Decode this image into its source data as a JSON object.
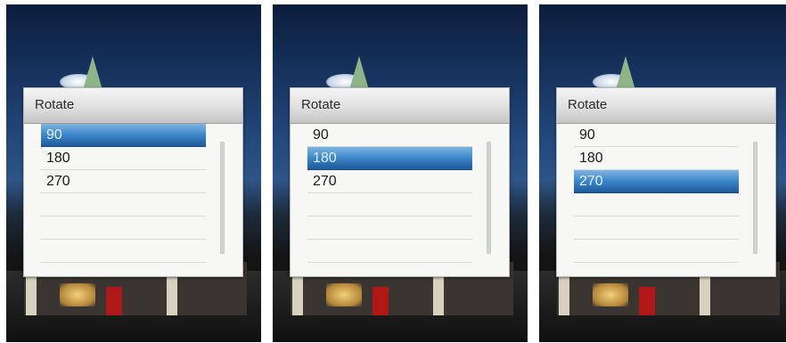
{
  "screens": [
    {
      "title": "Rotate",
      "options": [
        "90",
        "180",
        "270",
        "",
        "",
        ""
      ],
      "selected_index": 0
    },
    {
      "title": "Rotate",
      "options": [
        "90",
        "180",
        "270",
        "",
        "",
        ""
      ],
      "selected_index": 1
    },
    {
      "title": "Rotate",
      "options": [
        "90",
        "180",
        "270",
        "",
        "",
        ""
      ],
      "selected_index": 2
    }
  ],
  "colors": {
    "selection_top": "#7fb4e3",
    "selection_bottom": "#1e5a9a",
    "dialog_bg": "#f7f8f5",
    "header_bg": "#e0e0e0"
  }
}
